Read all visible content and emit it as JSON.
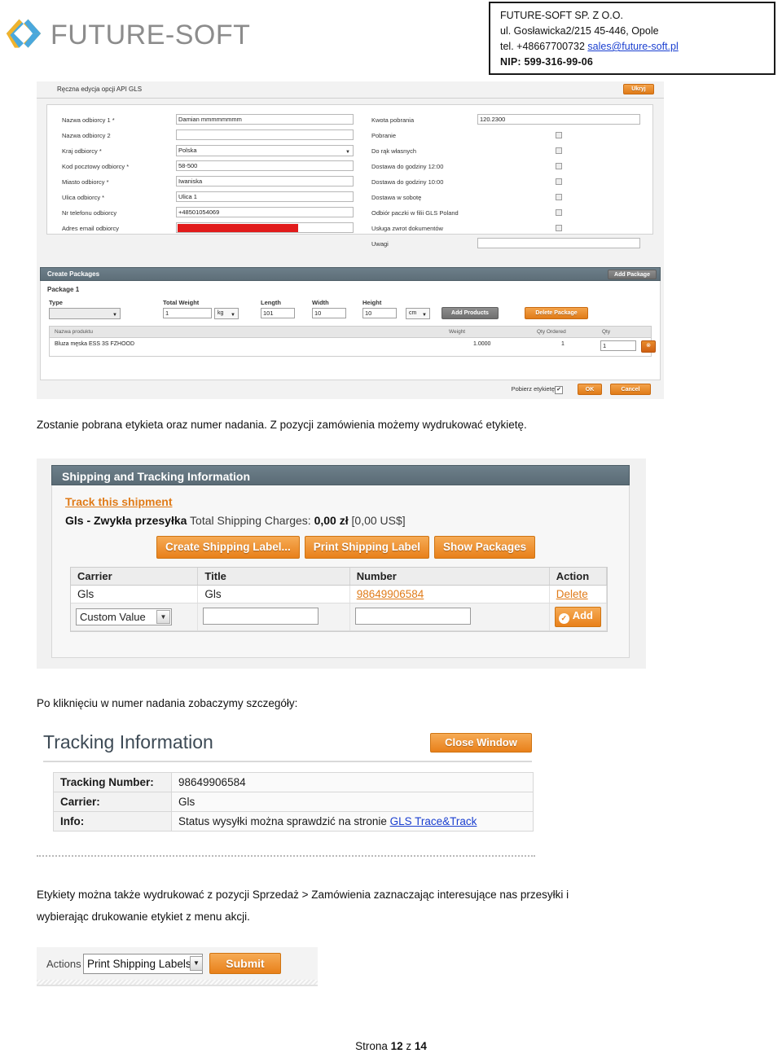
{
  "header": {
    "logo_text": "FUTURE-SOFT",
    "logo_icon": "future-soft-chevron-logo",
    "company": {
      "name": "FUTURE-SOFT SP. Z O.O.",
      "address": "ul. Gosławicka2/215 45-446, Opole",
      "phone_prefix": "tel. +48667700732 ",
      "email": "sales@future-soft.pl",
      "nip": "NIP: 599-316-99-06"
    }
  },
  "shot_gls_form": {
    "panel_title": "Ręczna edycja opcji API GLS",
    "hide_button": "Ukryj",
    "left_fields": [
      {
        "label": "Nazwa odbiorcy 1 *",
        "value": "Damian mmmmmmmm",
        "type": "text"
      },
      {
        "label": "Nazwa odbiorcy 2",
        "value": "",
        "type": "text"
      },
      {
        "label": "Kraj odbiorcy *",
        "value": "Polska",
        "type": "select"
      },
      {
        "label": "Kod pocztowy odbiorcy *",
        "value": "58-500",
        "type": "text"
      },
      {
        "label": "Miasto odbiorcy *",
        "value": "Iwaniska",
        "type": "text"
      },
      {
        "label": "Ulica odbiorcy *",
        "value": "Ulica 1",
        "type": "text"
      },
      {
        "label": "Nr telefonu odbiorcy",
        "value": "+48501054069",
        "type": "text"
      },
      {
        "label": "Adres email odbiorcy",
        "value": "",
        "type": "redacted"
      }
    ],
    "right_fields": [
      {
        "label": "Kwota pobrania",
        "value": "120.2300",
        "type": "text"
      },
      {
        "label": "Pobranie",
        "value": "",
        "type": "checkbox"
      },
      {
        "label": "Do rąk własnych",
        "value": "",
        "type": "checkbox"
      },
      {
        "label": "Dostawa do godziny 12:00",
        "value": "",
        "type": "checkbox"
      },
      {
        "label": "Dostawa do godziny 10:00",
        "value": "",
        "type": "checkbox"
      },
      {
        "label": "Dostawa w sobotę",
        "value": "",
        "type": "checkbox"
      },
      {
        "label": "Odbiór paczki w filii GLS Poland",
        "value": "",
        "type": "checkbox"
      },
      {
        "label": "Usługa zwrot dokumentów",
        "value": "",
        "type": "checkbox"
      },
      {
        "label": "Uwagi",
        "value": "",
        "type": "text"
      }
    ]
  },
  "shot_packages": {
    "title": "Create Packages",
    "add_package_button": "Add Package",
    "package_label": "Package 1",
    "type_caption": "Type",
    "type_value": "",
    "weight_caption": "Total Weight",
    "weight_value": "1",
    "weight_unit": "kg",
    "length_caption": "Length",
    "length_value": "101",
    "width_caption": "Width",
    "width_value": "10",
    "height_caption": "Height",
    "height_value": "10",
    "dim_unit": "cm",
    "add_products_button": "Add Products",
    "delete_package_button": "Delete Package",
    "product_columns": [
      "Nazwa produktu",
      "Weight",
      "Qty Ordered",
      "Qty"
    ],
    "product_row": {
      "name": "Bluza męska ESS 3S FZHOOD",
      "weight": "1.0000",
      "qty_ordered": "1",
      "qty": "1"
    },
    "remove_row_icon": "remove-circle-icon",
    "pobierz_label": "Pobierz etykietę",
    "pobierz_checked": "✔",
    "ok_button": "OK",
    "cancel_button": "Cancel"
  },
  "paragraphs": {
    "p1": "Zostanie pobrana etykieta oraz numer nadania. Z pozycji zamówienia możemy wydrukować etykietę.",
    "p2": "Po kliknięciu w numer nadania zobaczymy szczegóły:",
    "p3_line1": "Etykiety można także wydrukować z pozycji Sprzedaż > Zamówienia zaznaczając interesujące nas przesyłki i",
    "p3_line2": "wybierając drukowanie etykiet z menu akcji."
  },
  "shot_shipping": {
    "title": "Shipping and Tracking Information",
    "track_link": "Track this shipment",
    "carrier_method": "Gls - Zwykła przesyłka",
    "charges_label": " Total Shipping Charges: ",
    "charges_value": "0,00 zł",
    "charges_usd": " [0,00 US$]",
    "buttons": [
      "Create Shipping Label...",
      "Print Shipping Label",
      "Show Packages"
    ],
    "table_headers": [
      "Carrier",
      "Title",
      "Number",
      "Action"
    ],
    "table_row": {
      "carrier": "Gls",
      "title": "Gls",
      "number": "98649906584",
      "action": "Delete"
    },
    "add_row": {
      "carrier_select": "Custom Value",
      "title_input": "",
      "number_input": "",
      "add_button": "Add",
      "add_icon": "check-circle-icon"
    }
  },
  "shot_tracking": {
    "title": "Tracking Information",
    "close_button": "Close Window",
    "rows": [
      {
        "key": "Tracking Number:",
        "value": "98649906584"
      },
      {
        "key": "Carrier:",
        "value": "Gls"
      },
      {
        "key": "Info:",
        "value": "Status wysyłki można sprawdzić na stronie ",
        "link": "GLS Trace&Track"
      }
    ]
  },
  "shot_actions": {
    "actions_label": "Actions",
    "selected_action": "Print Shipping Labels",
    "submit_button": "Submit"
  },
  "footer": {
    "prefix": "Strona ",
    "current": "12",
    "middle": " z ",
    "total": "14"
  },
  "colors": {
    "orange": "#e8801a",
    "panel_blue_grey": "#5d6e78",
    "link_blue": "#1a3fd0",
    "redaction_red": "#e11b1b"
  }
}
